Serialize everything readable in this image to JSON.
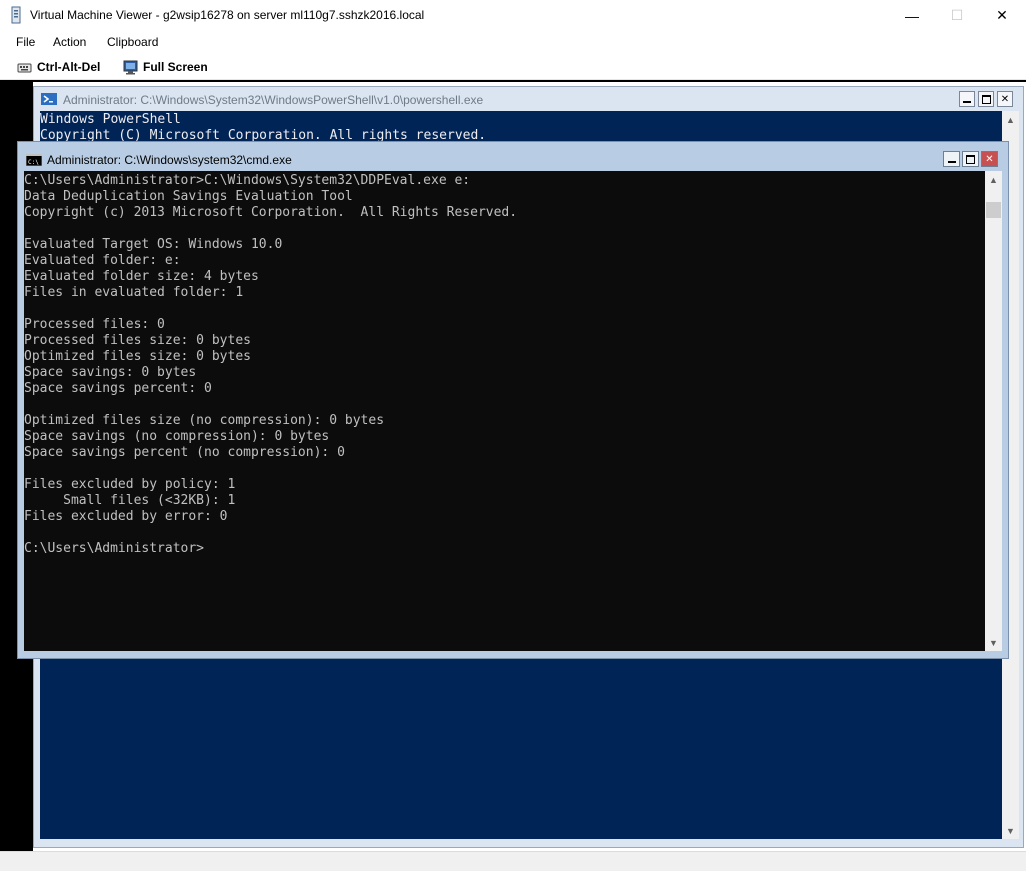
{
  "window": {
    "title": "Virtual Machine Viewer - g2wsip16278 on server ml110g7.sshzk2016.local",
    "minimize": "—",
    "maximize": "☐",
    "close": "✕"
  },
  "menu": [
    "File",
    "Action",
    "Clipboard"
  ],
  "toolbar": {
    "ctrl_alt_del": "Ctrl-Alt-Del",
    "full_screen": "Full Screen"
  },
  "powershell": {
    "title": "Administrator: C:\\Windows\\System32\\WindowsPowerShell\\v1.0\\powershell.exe",
    "lines": "Windows PowerShell\nCopyright (C) Microsoft Corporation. All rights reserved."
  },
  "cmd": {
    "title": "Administrator: C:\\Windows\\system32\\cmd.exe",
    "lines": "C:\\Users\\Administrator>C:\\Windows\\System32\\DDPEval.exe e:\nData Deduplication Savings Evaluation Tool\nCopyright (c) 2013 Microsoft Corporation.  All Rights Reserved.\n\nEvaluated Target OS: Windows 10.0\nEvaluated folder: e:\nEvaluated folder size: 4 bytes\nFiles in evaluated folder: 1\n\nProcessed files: 0\nProcessed files size: 0 bytes\nOptimized files size: 0 bytes\nSpace savings: 0 bytes\nSpace savings percent: 0\n\nOptimized files size (no compression): 0 bytes\nSpace savings (no compression): 0 bytes\nSpace savings percent (no compression): 0\n\nFiles excluded by policy: 1\n     Small files (<32KB): 1\nFiles excluded by error: 0\n\nC:\\Users\\Administrator>"
  },
  "colors": {
    "powershell_bg": "#012456",
    "cmd_bg": "#0c0c0c",
    "cmd_text": "#c0c0c0",
    "close_red": "#c75050"
  },
  "icons": {
    "app": "vm-viewer-icon",
    "ctrl_alt_del": "keyboard-icon",
    "full_screen": "monitor-icon",
    "powershell": "powershell-icon",
    "cmd": "cmd-icon"
  }
}
